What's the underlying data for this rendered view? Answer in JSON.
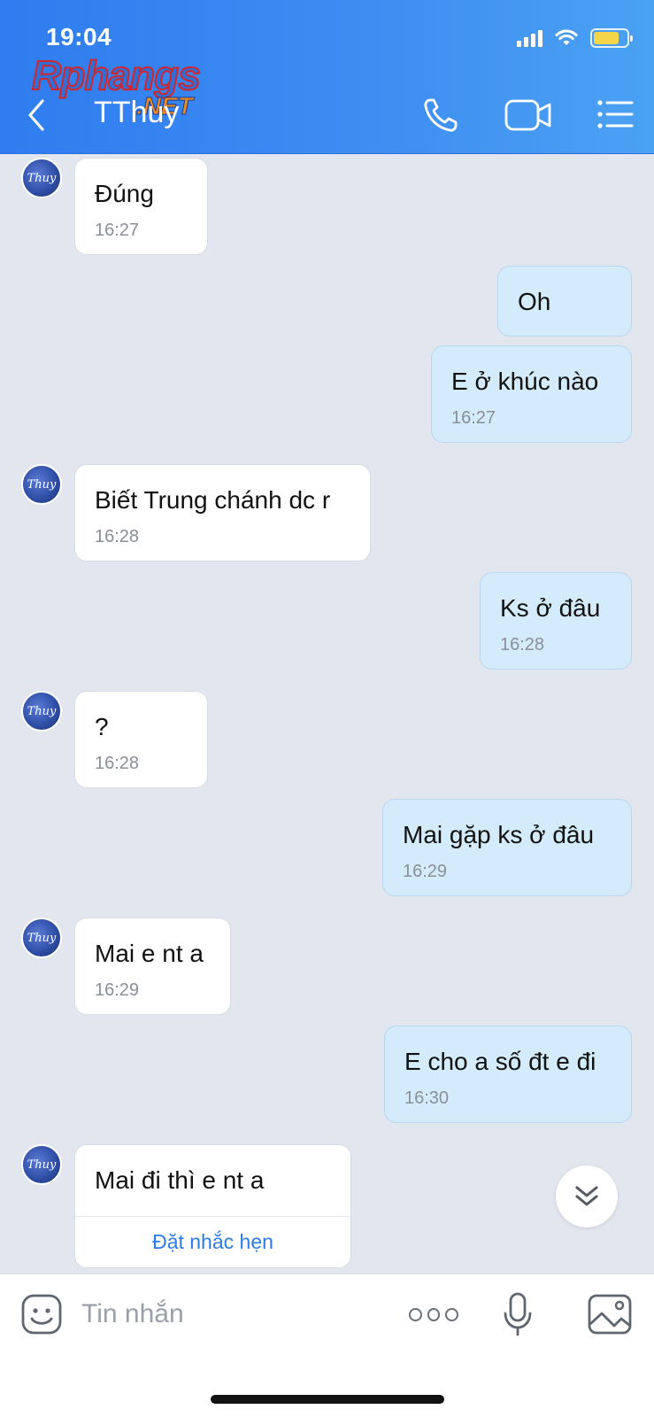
{
  "status": {
    "time": "19:04"
  },
  "watermark": {
    "main": "Rphangs",
    "sub": ".NET"
  },
  "header": {
    "title": "TThuy"
  },
  "avatar_label": "Thuy",
  "messages": [
    {
      "dir": "in",
      "text": "Đúng",
      "time": "16:27"
    },
    {
      "dir": "out",
      "text": "Oh",
      "time": ""
    },
    {
      "dir": "out",
      "text": "E ở khúc nào",
      "time": "16:27"
    },
    {
      "dir": "in",
      "text": "Biết Trung chánh dc r",
      "time": "16:28"
    },
    {
      "dir": "out",
      "text": "Ks ở đâu",
      "time": "16:28"
    },
    {
      "dir": "in",
      "text": "?",
      "time": "16:28"
    },
    {
      "dir": "out",
      "text": "Mai gặp ks ở đâu",
      "time": "16:29"
    },
    {
      "dir": "in",
      "text": "Mai e nt a",
      "time": "16:29"
    },
    {
      "dir": "out",
      "text": "E cho a số đt e đi",
      "time": "16:30"
    },
    {
      "dir": "in",
      "text": "Mai đi thì e nt a",
      "time": "",
      "action": "Đặt nhắc hẹn"
    }
  ],
  "input": {
    "placeholder": "Tin nhắn"
  },
  "icons": {
    "back": "chevron-left-icon",
    "call": "phone-icon",
    "video": "video-camera-icon",
    "menu": "list-menu-icon",
    "emoji": "emoji-icon",
    "more": "more-dots-icon",
    "mic": "microphone-icon",
    "image": "image-icon",
    "scroll": "double-chevron-down-icon"
  },
  "colors": {
    "header": "#2f7cf0",
    "outgoing_bubble": "#d4ebfb",
    "incoming_bubble": "#ffffff",
    "chat_bg": "#e2e6ee",
    "link": "#2d7be6"
  }
}
